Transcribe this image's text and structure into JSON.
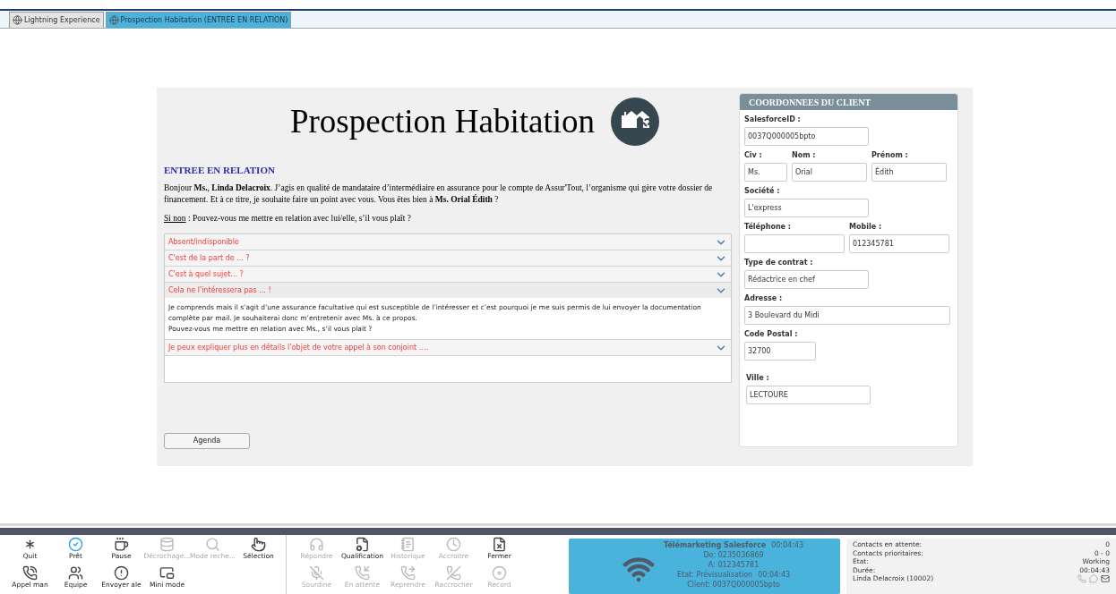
{
  "tabs": [
    {
      "label": "Lightning Experience",
      "selected": false
    },
    {
      "label": "Prospection Habitation (ENTREE EN RELATION)",
      "selected": true
    }
  ],
  "script": {
    "title": "Prospection Habitation",
    "section_heading": "ENTREE EN RELATION",
    "intro": "Bonjour **Ms.**, **Linda Delacroix**. J’agis en qualité de mandataire d’intermédiaire en assurance pour le compte de Assur'Tout, l’organisme qui gère votre dossier de financement. Et à ce titre, je souhaite faire un point avec vous. Vous êtes bien à **Ms. Orial Édith** ?",
    "si_non_label": "Si non",
    "si_non_text": " : Pouvez-vous me mettre en relation avec lui/elle, s’il vous plaît ?",
    "accordion": [
      {
        "label": "Absent/indisponible",
        "expanded": false
      },
      {
        "label": "C'est de la part de ... ?",
        "expanded": false
      },
      {
        "label": "C'est à quel sujet... ?",
        "expanded": false
      },
      {
        "label": "Cela ne l'intéressera pas ... !",
        "expanded": true,
        "body": [
          "Je comprends mais il s’agit d’une assurance facultative qui est susceptible de l’intéresser et c’est pourquoi je me suis permis de lui envoyer la documentation complète par mail. Je souhaiterai donc m’entretenir avec Ms. à ce propos.",
          "Pouvez-vous me mettre en relation avec Ms., s’il vous plait ?"
        ]
      },
      {
        "label": "Je peux expliquer plus en détails l’objet de votre appel à son conjoint ….",
        "expanded": false
      }
    ],
    "agenda_button": "Agenda"
  },
  "client_card": {
    "title": "COORDONNEES DU CLIENT",
    "rows": [
      [
        {
          "label": "SalesforceID :",
          "value": "0037Q000005bpto",
          "kind": "normal"
        }
      ],
      [
        {
          "label": "Civ :",
          "value": "Ms.",
          "kind": "narrow"
        },
        {
          "label": "Nom :",
          "value": "Orial",
          "kind": "medium"
        },
        {
          "label": "Prénom :",
          "value": "Édith",
          "kind": "medium"
        }
      ],
      [
        {
          "label": "Société :",
          "value": "L'express",
          "kind": "normal"
        }
      ],
      [
        {
          "label": "Téléphone :",
          "kind": "half"
        },
        {
          "label": "Mobile :",
          "value": "012345781",
          "kind": "half"
        }
      ],
      [
        {
          "label": "Type de contrat :",
          "value": "Rédactrice en chef",
          "kind": "normal"
        }
      ],
      [
        {
          "label": "Adresse :",
          "value": "3 Boulevard du Midi",
          "kind": "wide"
        }
      ],
      [
        {
          "label": "Code Postal :",
          "value": "32700",
          "kind": "short"
        }
      ],
      [
        {
          "label": "Ville :",
          "value": "LECTOURE",
          "kind": "normal"
        }
      ]
    ]
  },
  "toolbar": {
    "groups": [
      [
        [
          {
            "label": "Quit",
            "disabled": false
          },
          {
            "label": "Prêt",
            "disabled": false
          },
          {
            "label": "Pause",
            "disabled": false
          },
          {
            "label": "Décrochage...",
            "disabled": true
          },
          {
            "label": "Mode reche...",
            "disabled": true
          },
          {
            "label": "Sélection",
            "disabled": false
          }
        ],
        [
          {
            "label": "Appel man",
            "disabled": false
          },
          {
            "label": "Equipe",
            "disabled": false
          },
          {
            "label": "Envoyer ale",
            "disabled": false
          },
          {
            "label": "Mini mode",
            "disabled": false
          }
        ]
      ],
      [
        [
          {
            "label": "Répondre",
            "disabled": true
          },
          {
            "label": "Qualification",
            "disabled": false
          },
          {
            "label": "Historique",
            "disabled": true
          },
          {
            "label": "Accroitre",
            "disabled": true
          },
          {
            "label": "Fermer",
            "disabled": false
          }
        ],
        [
          {
            "label": "Sourdine",
            "disabled": true
          },
          {
            "label": "En attente",
            "disabled": true
          },
          {
            "label": "Reprendre",
            "disabled": true
          },
          {
            "label": "Raccrocher",
            "disabled": true
          },
          {
            "label": "Record",
            "disabled": true
          }
        ]
      ]
    ]
  },
  "call": {
    "campaign": "Télémarketing Salesforce",
    "timer": "00:04:43",
    "lines": [
      {
        "text": "De: 0235036869"
      },
      {
        "text": "A: 012345781"
      },
      {
        "text": "Etat: Prévisualisation",
        "time": "00:04:43"
      },
      {
        "text": "Client: 0037Q000005bpto"
      }
    ]
  },
  "stats": {
    "rows": [
      {
        "label": "Contacts en attente:",
        "value": "0"
      },
      {
        "label": "Contacts prioritaires:",
        "value": "0 - 0"
      },
      {
        "label": "Etat:",
        "value": "Working"
      },
      {
        "label": "Durée:",
        "value": "00:04:43"
      }
    ],
    "agent": "Linda Delacroix (10002)"
  }
}
